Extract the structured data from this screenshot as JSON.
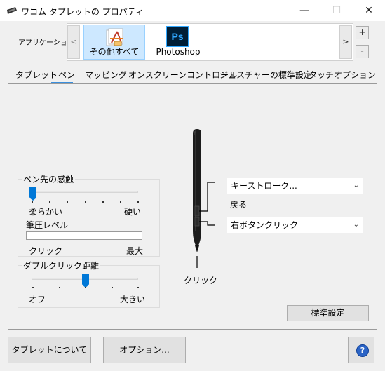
{
  "window": {
    "title": "ワコム タブレットの プロパティ",
    "minimize": "—",
    "maximize": "☐",
    "close": "✕"
  },
  "applications": {
    "label": "アプリケーション:",
    "prev": "<",
    "next": ">",
    "add": "+",
    "remove": "-",
    "items": [
      {
        "label": "その他すべて",
        "selected": true
      },
      {
        "label": "Photoshop",
        "icon_text": "Ps",
        "selected": false
      }
    ]
  },
  "tabs": [
    {
      "label": "タブレット",
      "active": false
    },
    {
      "label": "ペン",
      "active": true
    },
    {
      "label": "マッピング",
      "active": false
    },
    {
      "label": "オンスクリーンコントロール",
      "active": false
    },
    {
      "label": "ジェスチャーの標準設定",
      "active": false
    },
    {
      "label": "タッチオプション",
      "active": false
    }
  ],
  "tip_feel": {
    "label": "ペン先の感触",
    "min_label": "柔らかい",
    "max_label": "硬い",
    "level": 0,
    "pressure_label": "筆圧レベル",
    "pressure_value": 0,
    "click_label": "クリック",
    "max_pressure_label": "最大"
  },
  "double_click": {
    "label": "ダブルクリック距離",
    "min_label": "オフ",
    "max_label": "大きい",
    "level": 0.5
  },
  "pen": {
    "upper_button": "キーストローク...",
    "upper_sub": "戻る",
    "lower_button": "右ボタンクリック",
    "tip_label": "クリック"
  },
  "buttons": {
    "default": "標準設定",
    "about": "タブレットについて",
    "options": "オプション...",
    "help": "?"
  }
}
